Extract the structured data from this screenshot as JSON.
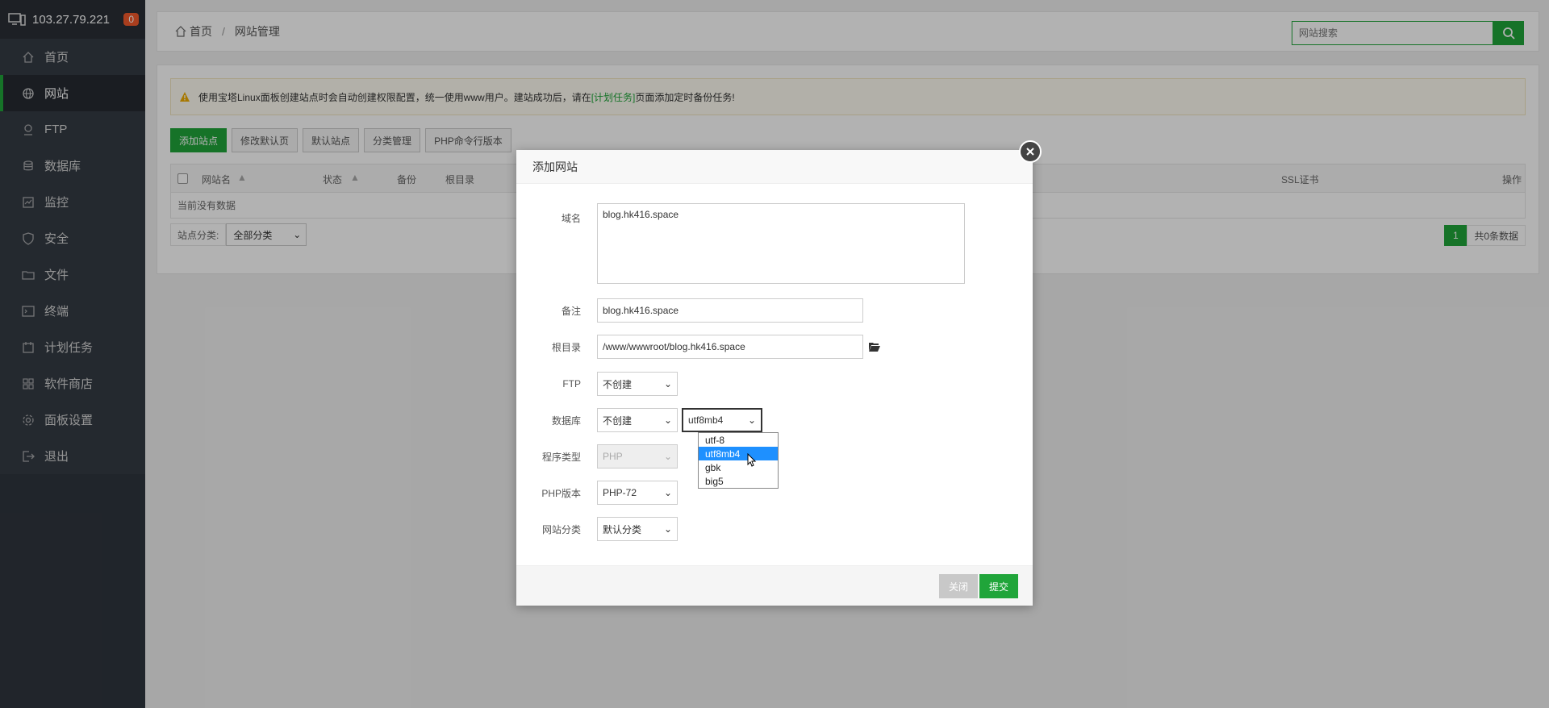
{
  "server": {
    "ip": "103.27.79.221",
    "badge": "0"
  },
  "sidebar": {
    "items": [
      {
        "label": "首页",
        "icon": "home-icon"
      },
      {
        "label": "网站",
        "icon": "globe-icon",
        "active": true
      },
      {
        "label": "FTP",
        "icon": "ftp-icon"
      },
      {
        "label": "数据库",
        "icon": "database-icon"
      },
      {
        "label": "监控",
        "icon": "monitor-icon"
      },
      {
        "label": "安全",
        "icon": "shield-icon"
      },
      {
        "label": "文件",
        "icon": "folder-icon"
      },
      {
        "label": "终端",
        "icon": "terminal-icon"
      },
      {
        "label": "计划任务",
        "icon": "calendar-icon"
      },
      {
        "label": "软件商店",
        "icon": "apps-icon"
      },
      {
        "label": "面板设置",
        "icon": "gear-icon"
      },
      {
        "label": "退出",
        "icon": "logout-icon"
      }
    ]
  },
  "breadcrumb": {
    "home": "首页",
    "current": "网站管理"
  },
  "search": {
    "placeholder": "网站搜索"
  },
  "alert": {
    "text_before": "使用宝塔Linux面板创建站点时会自动创建权限配置，统一使用www用户。建站成功后，请在",
    "link": "[计划任务]",
    "text_after": "页面添加定时备份任务!"
  },
  "toolbar": {
    "add_site": "添加站点",
    "modify_default": "修改默认页",
    "default_site": "默认站点",
    "category_mgmt": "分类管理",
    "php_cli": "PHP命令行版本"
  },
  "table": {
    "headers": {
      "name": "网站名",
      "status": "状态",
      "backup": "备份",
      "root": "根目录",
      "ssl": "SSL证书",
      "ops": "操作"
    },
    "empty": "当前没有数据"
  },
  "filter": {
    "label": "站点分类:",
    "value": "全部分类"
  },
  "pager": {
    "page": "1",
    "total": "共0条数据"
  },
  "modal": {
    "title": "添加网站",
    "domain_label": "域名",
    "domain_value": "blog.hk416.space",
    "note_label": "备注",
    "note_value": "blog.hk416.space",
    "root_label": "根目录",
    "root_value": "/www/wwwroot/blog.hk416.space",
    "ftp_label": "FTP",
    "ftp_value": "不创建",
    "db_label": "数据库",
    "db_value": "不创建",
    "charset_value": "utf8mb4",
    "charset_options": [
      "utf-8",
      "utf8mb4",
      "gbk",
      "big5"
    ],
    "prog_label": "程序类型",
    "prog_value": "PHP",
    "php_label": "PHP版本",
    "php_value": "PHP-72",
    "cat_label": "网站分类",
    "cat_value": "默认分类",
    "close_btn": "关闭",
    "submit_btn": "提交"
  }
}
